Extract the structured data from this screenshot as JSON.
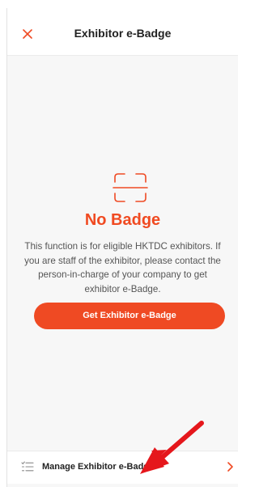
{
  "header": {
    "title": "Exhibitor e-Badge",
    "close_icon": "close-icon"
  },
  "empty_state": {
    "icon": "scan-frame-icon",
    "heading": "No Badge",
    "description": "This function is for eligible HKTDC exhibitors. If you are staff of the exhibitor, please contact the person-in-charge of your company to get exhibitor e-Badge.",
    "button_label": "Get Exhibitor e-Badge"
  },
  "footer": {
    "manage_label": "Manage Exhibitor e-Badge",
    "list_icon": "list-icon",
    "chevron_icon": "chevron-right-icon"
  },
  "colors": {
    "accent": "#ef4a23",
    "annotation_arrow": "#e5171c"
  }
}
